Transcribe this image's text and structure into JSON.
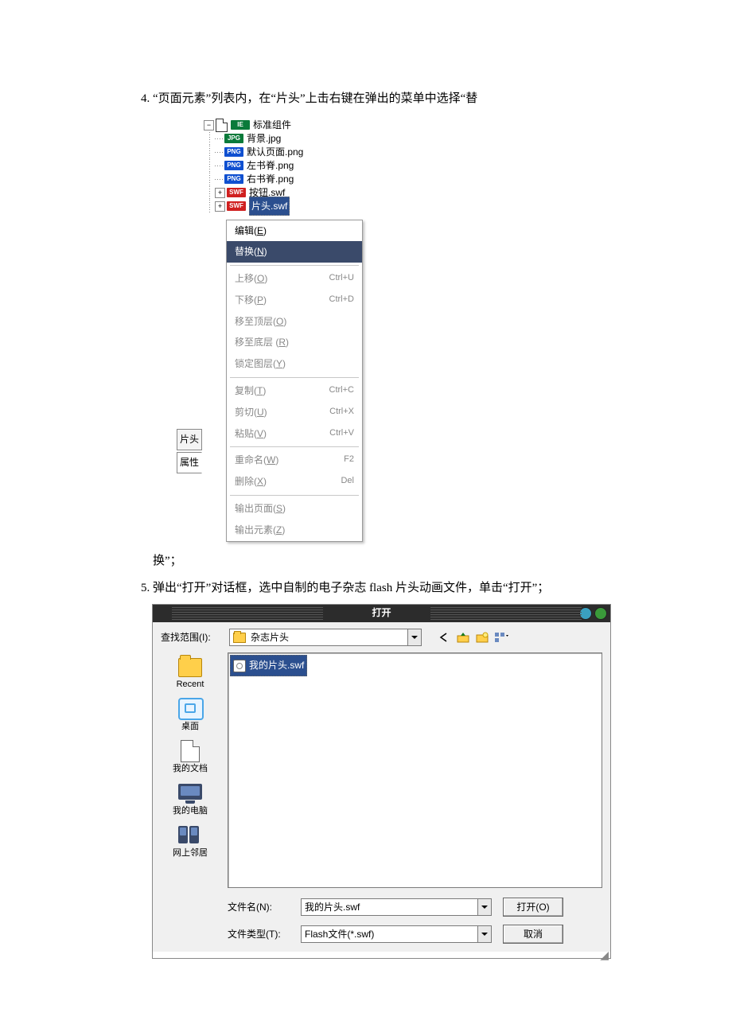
{
  "steps": {
    "s4_pre": "“页面元素”列表内，在“片头”上击右键在弹出的菜单中选择“替",
    "s4_post": "换”；",
    "s5": "弹出“打开”对话框，选中自制的电子杂志 flash 片头动画文件，单击“打开”；"
  },
  "tree": {
    "root": "标准组件",
    "items": [
      "背景.jpg",
      "默认页面.png",
      "左书脊.png",
      "右书脊.png",
      "按钮.swf",
      "片头.swf"
    ],
    "badges": [
      "JPG",
      "PNG",
      "PNG",
      "PNG",
      "SWF",
      "SWF"
    ],
    "root_badge": "IE",
    "side_tabs": [
      "片头",
      "属性"
    ]
  },
  "ctx": {
    "items": [
      {
        "label": "编辑(",
        "hk": "E",
        "tail": ")",
        "enabled": true
      },
      {
        "label": "替换(",
        "hk": "N",
        "tail": ")",
        "enabled": true,
        "hover": true
      },
      {
        "sep": true
      },
      {
        "label": "上移(",
        "hk": "O",
        "tail": ")",
        "sc": "Ctrl+U"
      },
      {
        "label": "下移(",
        "hk": "P",
        "tail": ")",
        "sc": "Ctrl+D"
      },
      {
        "label": "移至顶层(",
        "hk": "O",
        "tail": ")"
      },
      {
        "label": "移至底层 (",
        "hk": "R",
        "tail": ")"
      },
      {
        "label": "锁定图层(",
        "hk": "Y",
        "tail": ")"
      },
      {
        "sep": true
      },
      {
        "label": "复制(",
        "hk": "T",
        "tail": ")",
        "sc": "Ctrl+C"
      },
      {
        "label": "剪切(",
        "hk": "U",
        "tail": ")",
        "sc": "Ctrl+X"
      },
      {
        "label": "粘贴(",
        "hk": "V",
        "tail": ")",
        "sc": "Ctrl+V"
      },
      {
        "sep": true
      },
      {
        "label": "重命名(",
        "hk": "W",
        "tail": ")",
        "sc": "F2"
      },
      {
        "label": "删除(",
        "hk": "X",
        "tail": ")",
        "sc": "Del"
      },
      {
        "sep": true
      },
      {
        "label": "输出页面(",
        "hk": "S",
        "tail": ")"
      },
      {
        "label": "输出元素(",
        "hk": "Z",
        "tail": ")"
      }
    ]
  },
  "dlg": {
    "title": "打开",
    "lookin_label": "查找范围(I):",
    "lookin_value": "杂志片头",
    "places": [
      "Recent",
      "桌面",
      "我的文档",
      "我的电脑",
      "网上邻居"
    ],
    "selected_file": "我的片头.swf",
    "filename_label": "文件名(N):",
    "filename_value": "我的片头.swf",
    "filetype_label": "文件类型(T):",
    "filetype_value": "Flash文件(*.swf)",
    "open_btn": "打开(O)",
    "cancel_btn": "取消",
    "toolbar_icons": [
      "back-icon",
      "up-icon",
      "new-folder-icon",
      "views-icon"
    ]
  }
}
